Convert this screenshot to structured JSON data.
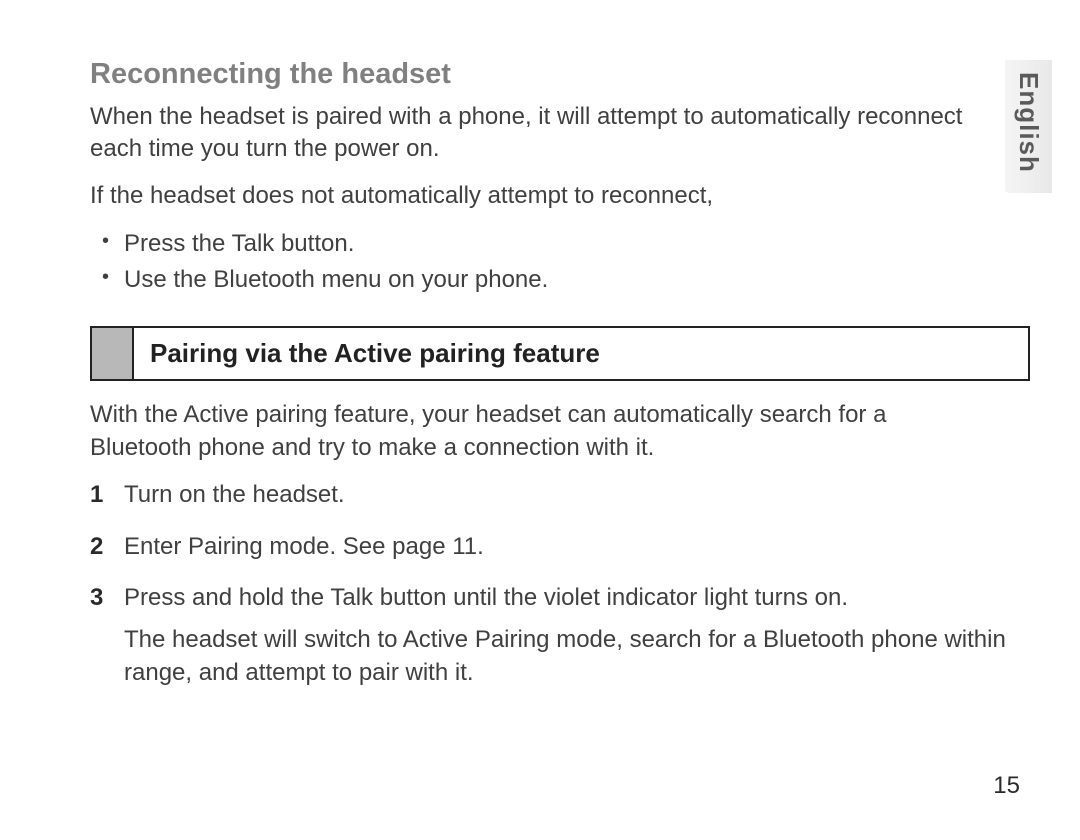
{
  "language_tab": "English",
  "section1": {
    "heading": "Reconnecting the headset",
    "para1": "When the headset is paired with a phone, it will attempt to automatically reconnect each time you turn the power on.",
    "para2": "If the headset does not automatically attempt to reconnect,",
    "bullets": [
      "Press the Talk button.",
      "Use the Bluetooth menu on your phone."
    ]
  },
  "section2": {
    "heading": "Pairing via the Active pairing feature",
    "para1": "With the Active pairing feature, your headset can automatically search for a Bluetooth phone and try to make a connection with it.",
    "steps": [
      {
        "main": "Turn on the headset."
      },
      {
        "main": "Enter Pairing mode. See page 11."
      },
      {
        "main": "Press and hold the Talk button until the violet indicator light turns on.",
        "sub": "The headset will switch to Active Pairing mode, search for a Bluetooth phone within range, and attempt to pair with it."
      }
    ]
  },
  "page_number": "15"
}
